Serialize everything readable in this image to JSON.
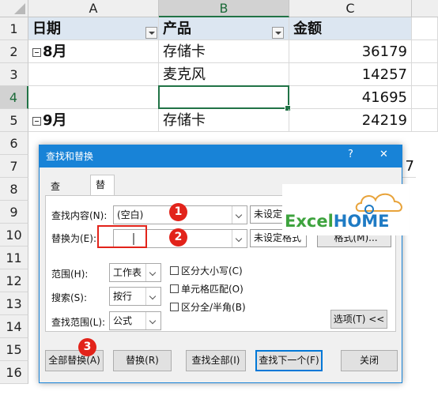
{
  "sheet": {
    "columns": [
      "A",
      "B",
      "C"
    ],
    "rows": [
      "1",
      "2",
      "3",
      "4",
      "5",
      "6",
      "7",
      "8",
      "9",
      "10",
      "11",
      "12",
      "13",
      "14",
      "15",
      "16"
    ],
    "header": {
      "date": "日期",
      "product": "产品",
      "amount": "金额"
    },
    "cells": {
      "r2_a": "8月",
      "r2_b": "存储卡",
      "r2_c": "36179",
      "r3_b": "麦克风",
      "r3_c": "14257",
      "r4_c": "41695",
      "r5_a": "9月",
      "r5_b": "存储卡",
      "r5_c": "24219",
      "r7_c_partial": "7"
    }
  },
  "dialog": {
    "title": "查找和替换",
    "help": "?",
    "close": "✕",
    "tabs": [
      "查找(D)",
      "替换(P)"
    ],
    "find_label": "查找内容(N):",
    "find_value": "(空白)",
    "find_format": "未设定",
    "replace_label": "替换为(E):",
    "replace_value": "",
    "replace_format": "未设定格式",
    "format_button": "格式(M)...",
    "scope_label": "范围(H):",
    "scope_value": "工作表",
    "search_label": "搜索(S):",
    "search_value": "按行",
    "lookin_label": "查找范围(L):",
    "lookin_value": "公式",
    "match_case": "区分大小写(C)",
    "match_cell": "单元格匹配(O)",
    "match_width": "区分全/半角(B)",
    "options_button": "选项(T) <<",
    "buttons": {
      "replace_all": "全部替换(A)",
      "replace": "替换(R)",
      "find_all": "查找全部(I)",
      "find_next": "查找下一个(F)",
      "close": "关闭"
    }
  },
  "annotations": {
    "one": "1",
    "two": "2",
    "three": "3"
  },
  "watermark": {
    "excel": "Excel",
    "home": "HOME"
  },
  "colors": {
    "accent": "#217346",
    "dialog_title": "#1883d7",
    "badge": "#e2231a"
  }
}
